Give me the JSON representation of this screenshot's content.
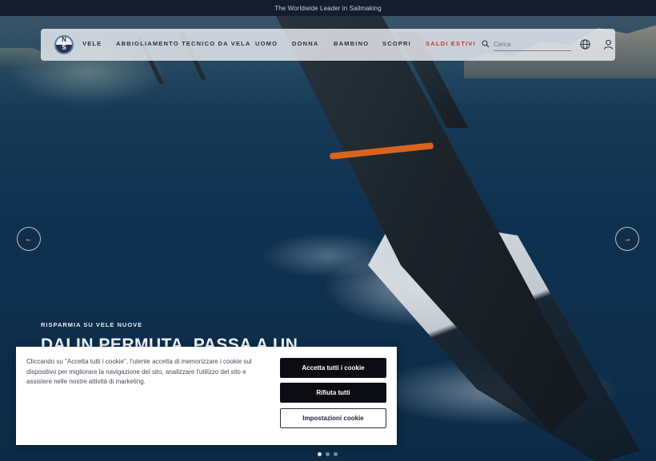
{
  "announcement": "The Worldwide Leader in Sailmaking",
  "logo": {
    "top_letter": "N",
    "bottom_letter": "S"
  },
  "nav": {
    "items": [
      {
        "label": "VELE",
        "sale": false
      },
      {
        "label": "ABBIGLIAMENTO TECNICO DA VELA",
        "sale": false
      },
      {
        "label": "UOMO",
        "sale": false
      },
      {
        "label": "DONNA",
        "sale": false
      },
      {
        "label": "BAMBINO",
        "sale": false
      },
      {
        "label": "SCOPRI",
        "sale": false
      },
      {
        "label": "SALDI ESTIVI",
        "sale": true
      }
    ],
    "search_placeholder": "Cerca",
    "sale_color": "#c0392b"
  },
  "hero": {
    "eyebrow": "RISPARMIA SU VELE NUOVE",
    "headline": "DAI IN PERMUTA, PASSA A UN",
    "prev_arrow": "←",
    "next_arrow": "→",
    "slides": 3,
    "active_slide": 1
  },
  "cookie": {
    "text": "Cliccando su \"Accetta tutti i cookie\", l'utente accetta di memorizzare i cookie sul dispositivo per migliorare la navigazione del sito, analizzare l'utilizzo del sito e assistere nelle nostre attività di marketing.",
    "accept_all": "Accetta tutti i cookie",
    "reject_all": "Rifiuta tutti",
    "settings": "Impostazioni cookie"
  },
  "colors": {
    "topbar_bg": "#141d2d",
    "button_dark": "#0b0d12"
  }
}
